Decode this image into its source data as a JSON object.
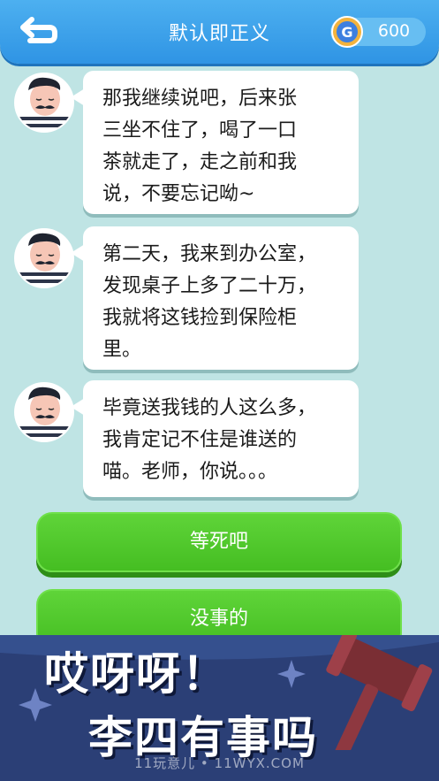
{
  "header": {
    "back_icon": "return-arrow-icon",
    "title": "默认即正义",
    "coin_icon": "g-coin-icon",
    "coin_value": "600"
  },
  "chat": {
    "messages": [
      {
        "lines": [
          "那我继续说吧，后来张",
          "三坐不住了，喝了一口",
          "茶就走了，走之前和我",
          "说，不要忘记呦~"
        ]
      },
      {
        "lines": [
          "第二天，我来到办公室，",
          "发现桌子上多了二十万，",
          "我就将这钱捡到保险柜",
          "里。"
        ]
      },
      {
        "lines": [
          "毕竟送我钱的人这么多，",
          "我肯定记不住是谁送的",
          "喵。老师，你说。。。"
        ]
      }
    ]
  },
  "choices": [
    {
      "label": "等死吧"
    },
    {
      "label": "没事的"
    }
  ],
  "banner": {
    "line1": "哎呀呀！",
    "line2": "李四有事吗",
    "watermark": "11玩意儿 • 11WYX.COM"
  },
  "colors": {
    "background": "#bfe4e4",
    "header": "#2f94e4",
    "choice_green": "#45be22",
    "banner_navy": "#2b3f76"
  }
}
